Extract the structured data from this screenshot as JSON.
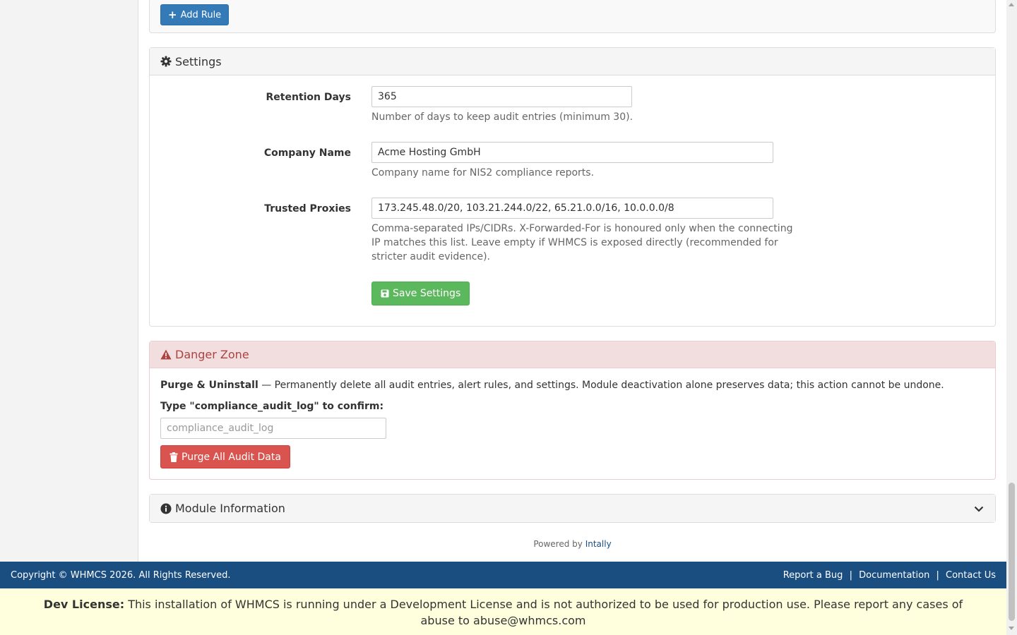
{
  "rules_panel": {
    "add_rule_label": "Add Rule"
  },
  "settings": {
    "title": "Settings",
    "fields": [
      {
        "label": "Retention Days",
        "value": "365",
        "help": "Number of days to keep audit entries (minimum 30)."
      },
      {
        "label": "Company Name",
        "value": "Acme Hosting GmbH",
        "help": "Company name for NIS2 compliance reports."
      },
      {
        "label": "Trusted Proxies",
        "value": "173.245.48.0/20, 103.21.244.0/22, 65.21.0.0/16, 10.0.0.0/8",
        "help_lines": [
          "Comma-separated IPs/CIDRs. X-Forwarded-For is honoured only when the connecting",
          "IP matches this list. Leave empty if WHMCS is exposed directly (recommended for",
          "stricter audit evidence)."
        ]
      }
    ],
    "save_label": "Save Settings"
  },
  "danger_zone": {
    "title": "Danger Zone",
    "purge_title": "Purge & Uninstall",
    "purge_text": " — Permanently delete all audit entries, alert rules, and settings. Module deactivation alone preserves data; this action cannot be undone.",
    "confirm_label": "Type \"compliance_audit_log\" to confirm:",
    "confirm_placeholder": "compliance_audit_log",
    "purge_button_label": "Purge All Audit Data"
  },
  "module_info": {
    "title": "Module Information"
  },
  "powered_by": {
    "prefix": "Powered by",
    "link": "Intally"
  },
  "footer": {
    "copyright": "Copyright © WHMCS 2026. All Rights Reserved.",
    "links": [
      "Report a Bug",
      "Documentation",
      "Contact Us"
    ],
    "separator": "|"
  },
  "dev_license": {
    "label": "Dev License:",
    "text": " This installation of WHMCS is running under a Development License and is not authorized to be used for production use. Please report any cases of abuse to abuse@whmcs.com"
  },
  "colors": {
    "primary": "#337ab7",
    "success": "#5cb85c",
    "danger": "#d9534f",
    "danger_text": "#a94442",
    "danger_bg": "#f2dede",
    "footer_bg": "#1a4d80",
    "license_bg": "#ffffdd"
  },
  "icons": {
    "add": "plus-icon",
    "settings": "gear-icon",
    "save": "floppy-disk-icon",
    "danger": "warning-triangle-icon",
    "purge": "trash-icon",
    "info": "info-circle-icon",
    "expand": "chevron-down-icon"
  }
}
